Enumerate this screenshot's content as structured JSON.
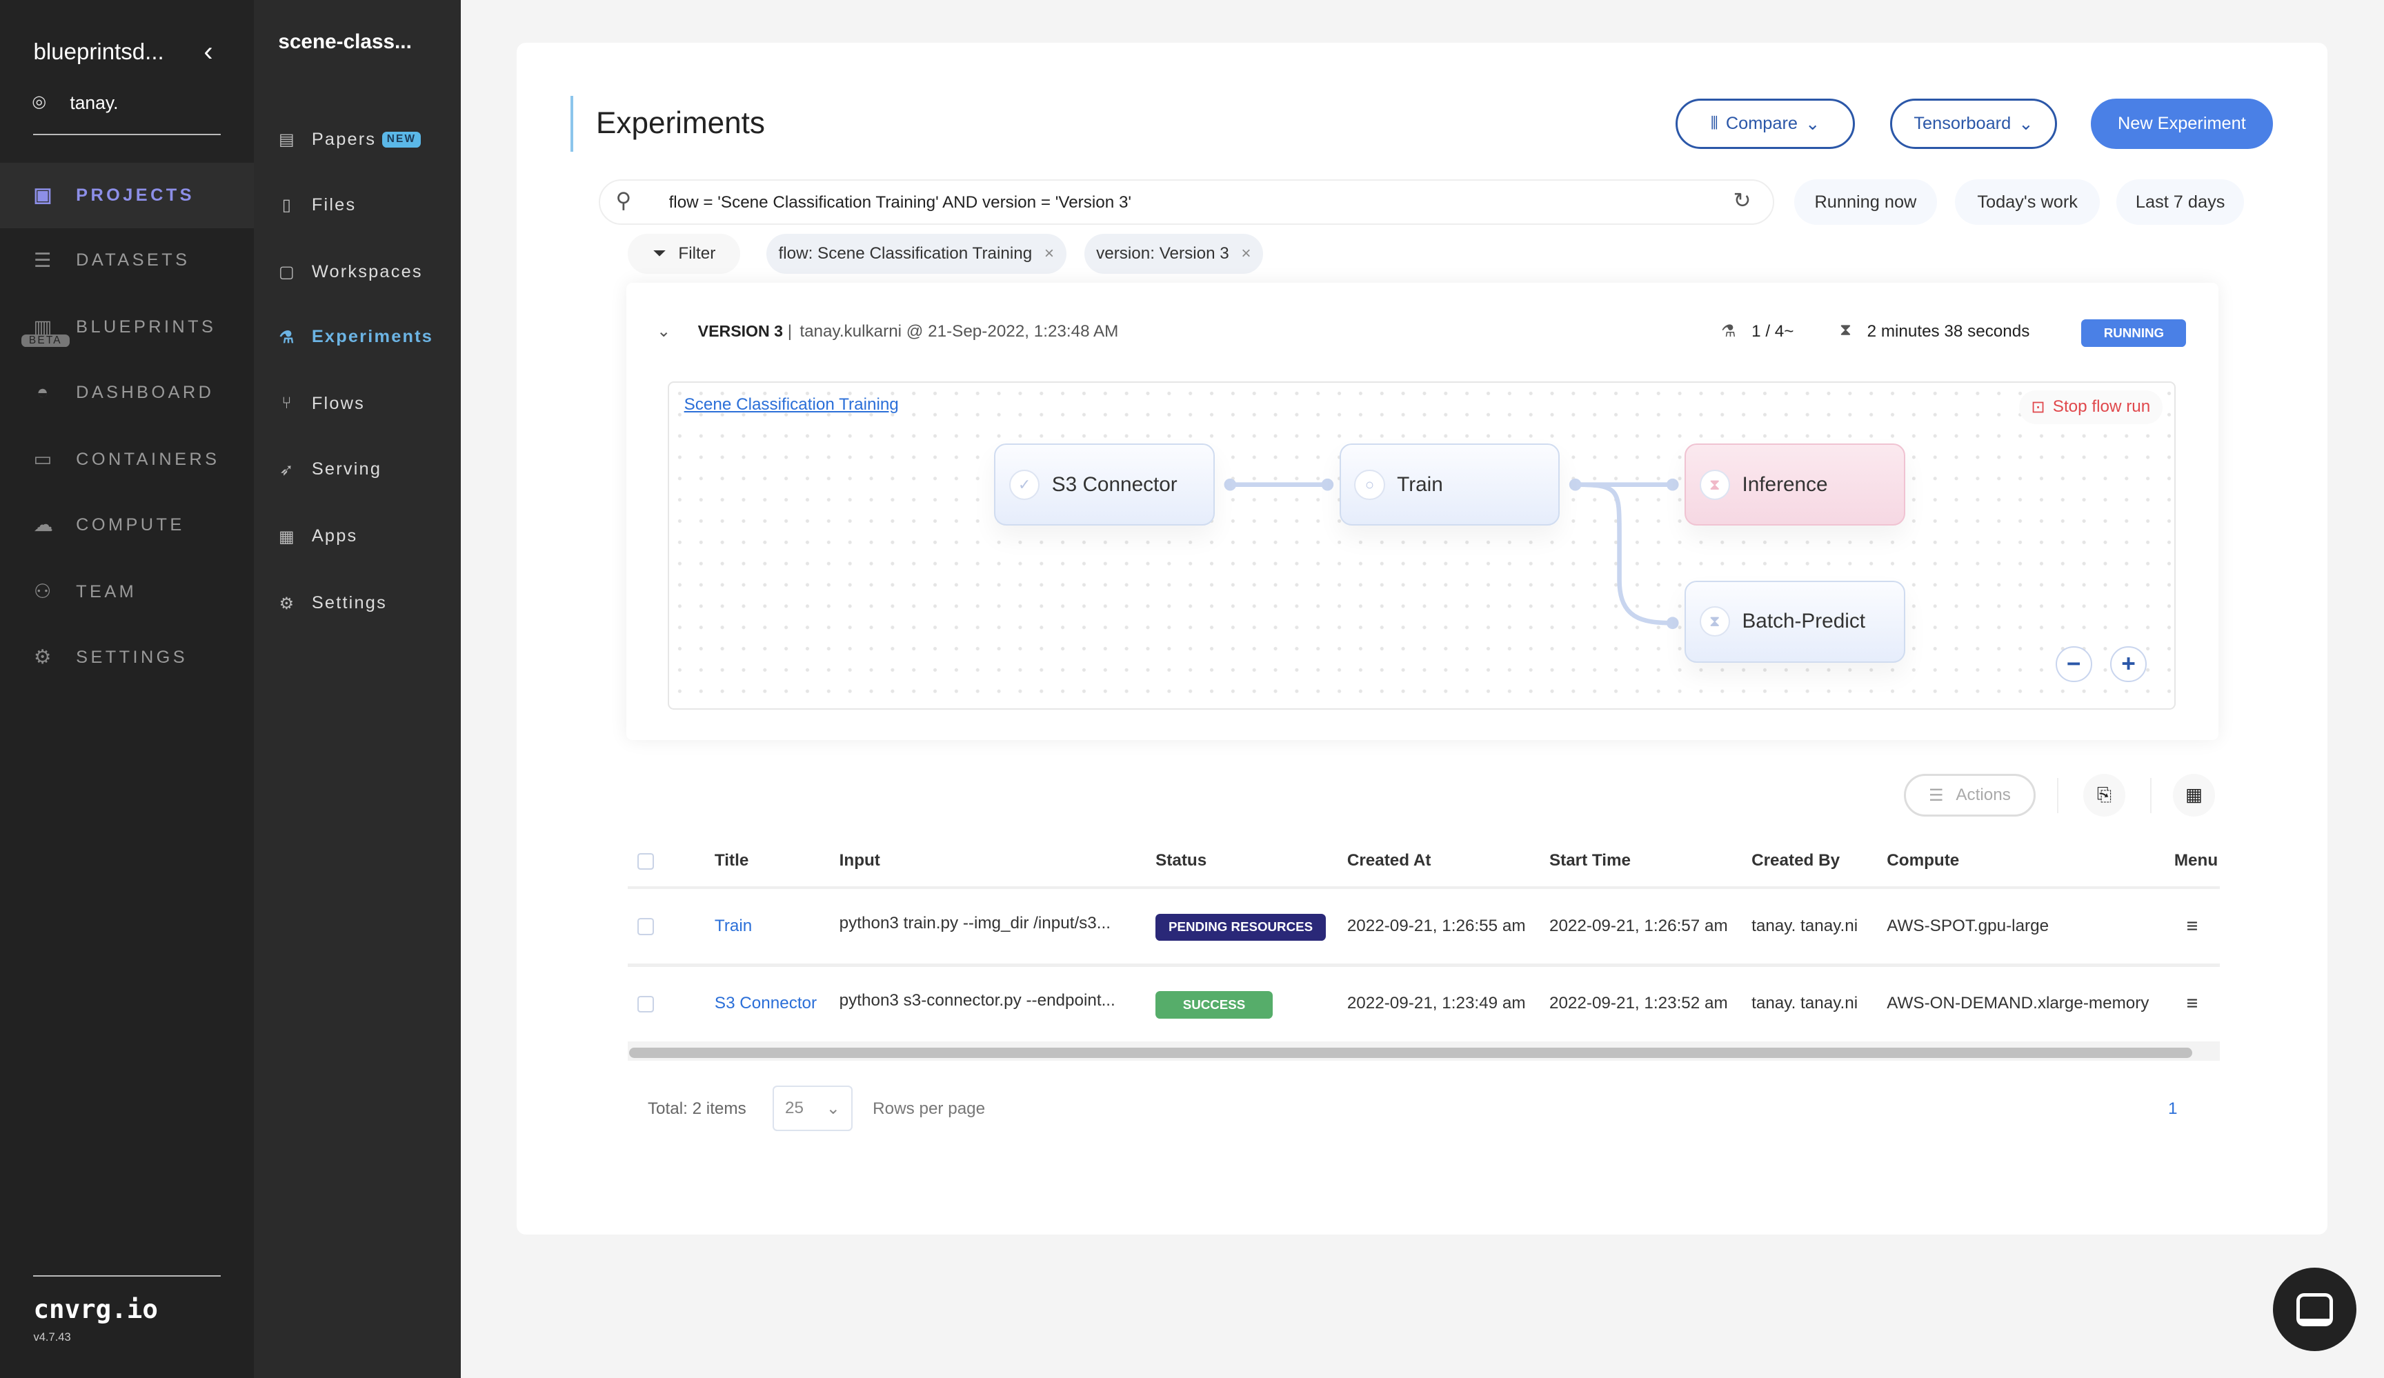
{
  "sidebar": {
    "org": "blueprintsd...",
    "user": "tanay.",
    "items": [
      {
        "label": "PROJECTS",
        "icon": "projects-icon"
      },
      {
        "label": "DATASETS",
        "icon": "database-icon"
      },
      {
        "label": "BLUEPRINTS",
        "icon": "books-icon",
        "badge": "BETA"
      },
      {
        "label": "DASHBOARD",
        "icon": "gauge-icon"
      },
      {
        "label": "CONTAINERS",
        "icon": "box-icon"
      },
      {
        "label": "COMPUTE",
        "icon": "cloud-icon"
      },
      {
        "label": "TEAM",
        "icon": "team-icon"
      },
      {
        "label": "SETTINGS",
        "icon": "gears-icon"
      }
    ],
    "brand": "cnvrg.io",
    "version": "v4.7.43"
  },
  "project_nav": {
    "title": "scene-class...",
    "items": [
      {
        "label": "Papers",
        "badge": "NEW"
      },
      {
        "label": "Files"
      },
      {
        "label": "Workspaces"
      },
      {
        "label": "Experiments"
      },
      {
        "label": "Flows"
      },
      {
        "label": "Serving"
      },
      {
        "label": "Apps"
      },
      {
        "label": "Settings"
      }
    ]
  },
  "header": {
    "title": "Experiments",
    "compare": "Compare",
    "tensorboard": "Tensorboard",
    "new_experiment": "New Experiment"
  },
  "search": {
    "value": "flow = 'Scene Classification Training' AND version = 'Version 3'",
    "quick": [
      "Running now",
      "Today's work",
      "Last 7 days"
    ]
  },
  "filters": {
    "label": "Filter",
    "chips": [
      "flow: Scene Classification Training",
      "version: Version 3"
    ]
  },
  "version": {
    "name": "VERSION 3",
    "meta": "tanay.kulkarni @ 21-Sep-2022, 1:23:48 AM",
    "steps": "1 / 4~",
    "duration": "2 minutes 38 seconds",
    "status": "RUNNING",
    "flow_link": "Scene Classification Training",
    "stop": "Stop flow run",
    "nodes": [
      {
        "label": "S3 Connector",
        "state": "success"
      },
      {
        "label": "Train",
        "state": "running"
      },
      {
        "label": "Inference",
        "state": "pending"
      },
      {
        "label": "Batch-Predict",
        "state": "pending"
      }
    ]
  },
  "toolbar": {
    "actions": "Actions"
  },
  "table": {
    "columns": [
      "Title",
      "Input",
      "Status",
      "Created At",
      "Start Time",
      "Created By",
      "Compute",
      "Menu"
    ],
    "rows": [
      {
        "title": "Train",
        "input": "python3 train.py --img_dir /input/s3...",
        "status": "PENDING RESOURCES",
        "status_color": "#2a2878",
        "created": "2022-09-21, 1:26:55 am",
        "start": "2022-09-21, 1:26:57 am",
        "by": "tanay. tanay.ni",
        "compute": "AWS-SPOT.gpu-large"
      },
      {
        "title": "S3 Connector",
        "input": "python3 s3-connector.py --endpoint...",
        "status": "SUCCESS",
        "status_color": "#56ad6a",
        "created": "2022-09-21, 1:23:49 am",
        "start": "2022-09-21, 1:23:52 am",
        "by": "tanay. tanay.ni",
        "compute": "AWS-ON-DEMAND.xlarge-memory"
      }
    ]
  },
  "pagination": {
    "total": "Total: 2 items",
    "page_size": "25",
    "rows_per_page": "Rows per page",
    "page": "1"
  }
}
